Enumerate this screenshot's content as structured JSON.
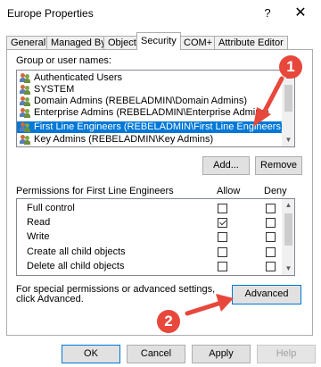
{
  "window": {
    "title": "Europe Properties",
    "help": "?",
    "close": "✕"
  },
  "tabs": [
    "General",
    "Managed By",
    "Object",
    "Security",
    "COM+",
    "Attribute Editor"
  ],
  "groups": {
    "label": "Group or user names:",
    "items": [
      "Authenticated Users",
      "SYSTEM",
      "Domain Admins (REBELADMIN\\Domain Admins)",
      "Enterprise Admins (REBELADMIN\\Enterprise Admins)",
      "First Line Engineers (REBELADMIN\\First Line Engineers)",
      "Key Admins (REBELADMIN\\Key Admins)"
    ],
    "selected_index": 4,
    "add_label": "Add...",
    "remove_label": "Remove"
  },
  "permissions": {
    "label": "Permissions for First Line Engineers",
    "allow_header": "Allow",
    "deny_header": "Deny",
    "rows": [
      {
        "name": "Full control",
        "allow": false,
        "deny": false
      },
      {
        "name": "Read",
        "allow": true,
        "deny": false
      },
      {
        "name": "Write",
        "allow": false,
        "deny": false
      },
      {
        "name": "Create all child objects",
        "allow": false,
        "deny": false
      },
      {
        "name": "Delete all child objects",
        "allow": false,
        "deny": false
      }
    ]
  },
  "advanced": {
    "text": "For special permissions or advanced settings, click Advanced.",
    "button_label": "Advanced"
  },
  "footer": {
    "ok": "OK",
    "cancel": "Cancel",
    "apply": "Apply",
    "help": "Help"
  },
  "annotations": {
    "badge_1": "1",
    "badge_2": "2",
    "color": "#e8473c"
  },
  "colors": {
    "selection": "#0078d7",
    "accent_border": "#0078d7"
  }
}
